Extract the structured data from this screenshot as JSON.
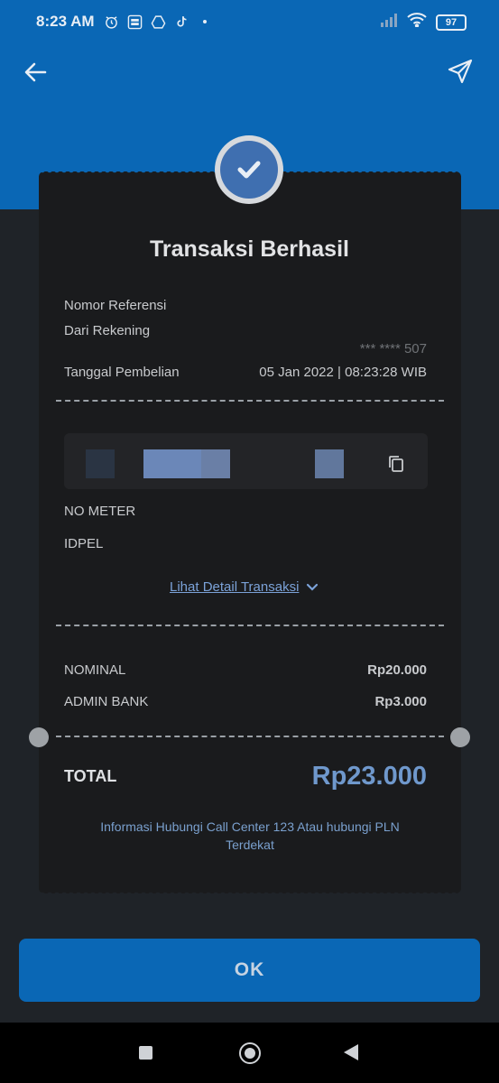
{
  "status_bar": {
    "time": "8:23 AM",
    "battery": "97",
    "icons_left": [
      "alarm-icon",
      "bri-icon",
      "drive-icon",
      "tiktok-icon",
      "dot-icon"
    ],
    "icons_right": [
      "signal-icon",
      "wifi-icon",
      "battery-icon"
    ]
  },
  "nav": {
    "back_icon": "arrow-left-icon",
    "share_icon": "send-icon"
  },
  "receipt": {
    "title": "Transaksi Berhasil",
    "rows": {
      "ref_label": "Nomor Referensi",
      "from_label": "Dari Rekening",
      "from_value": "*** **** 507",
      "date_label": "Tanggal Pembelian",
      "date_value": "05 Jan 2022 | 08:23:28 WIB"
    },
    "meter_label": "NO METER",
    "idpel_label": "IDPEL",
    "detail_link": "Lihat Detail Transaksi",
    "nominal_label": "NOMINAL",
    "nominal_value": "Rp20.000",
    "admin_label": "ADMIN BANK",
    "admin_value": "Rp3.000",
    "total_label": "TOTAL",
    "total_value": "Rp23.000",
    "info": "Informasi Hubungi Call Center 123 Atau hubungi PLN Terdekat"
  },
  "ok_button": "OK",
  "colors": {
    "brand": "#0a67b5",
    "accent": "#6f98cc",
    "card": "#1a1b1d",
    "background": "#1f2328"
  }
}
